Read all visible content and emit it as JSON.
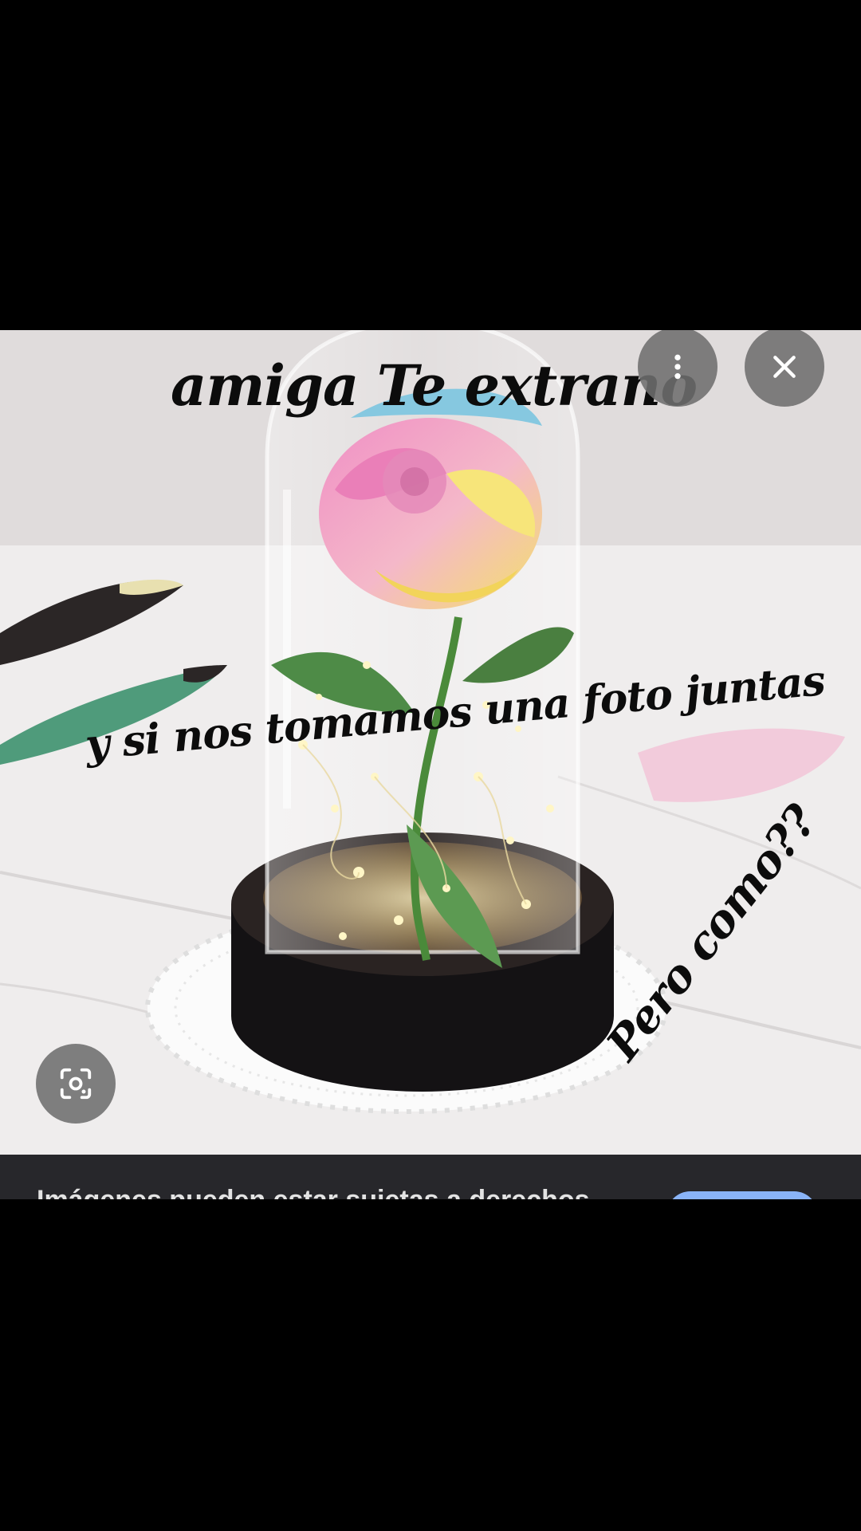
{
  "image_viewer": {
    "caption_top": "amiga Te extrano",
    "caption_middle": "y si nos tomamos una foto juntas",
    "caption_corner": "Pero como??",
    "buttons": {
      "more": {
        "icon": "more-vert-icon"
      },
      "close": {
        "icon": "close-icon"
      },
      "lens": {
        "icon": "lens-search-icon"
      }
    }
  },
  "bottom_bar": {
    "partial_text": "Imágenes pueden estar sujetas a derechos",
    "accent_color": "#8ab4f8"
  }
}
